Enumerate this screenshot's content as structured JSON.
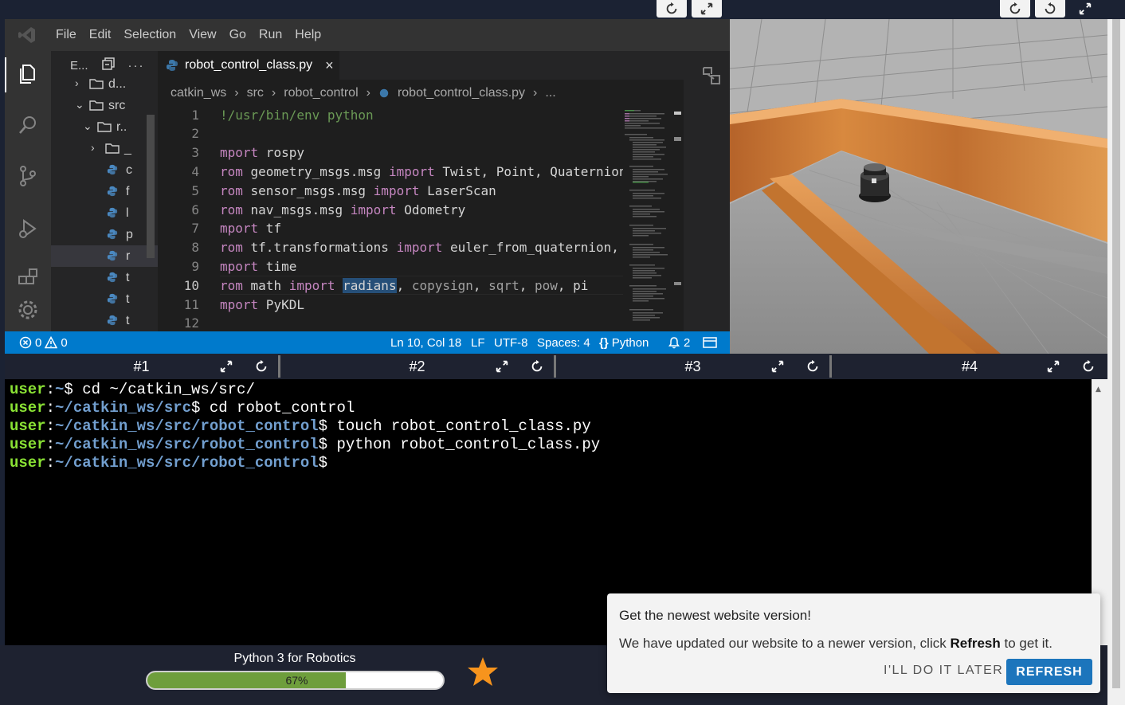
{
  "top_controls": {
    "left_group": [
      "reload",
      "fullscreen"
    ],
    "right_group": [
      "reload",
      "refresh",
      "fullscreen"
    ]
  },
  "vscode": {
    "menu": [
      "File",
      "Edit",
      "Selection",
      "View",
      "Go",
      "Run",
      "Help"
    ],
    "explorer_label": "E...",
    "explorer_tree": [
      {
        "label": "d...",
        "type": "folder",
        "partial": true
      },
      {
        "label": "src",
        "type": "folder-open"
      },
      {
        "label": "r..",
        "type": "folder-open"
      },
      {
        "label": "_",
        "type": "folder"
      },
      {
        "label": "c",
        "type": "python"
      },
      {
        "label": "f",
        "type": "python"
      },
      {
        "label": "l",
        "type": "python"
      },
      {
        "label": "p",
        "type": "python"
      },
      {
        "label": "r",
        "type": "python",
        "selected": true
      },
      {
        "label": "t",
        "type": "python"
      },
      {
        "label": "t",
        "type": "python"
      },
      {
        "label": "t",
        "type": "python"
      }
    ],
    "tab": {
      "name": "robot_control_class.py",
      "close": "×"
    },
    "breadcrumb": [
      "catkin_ws",
      "src",
      "robot_control",
      "robot_control_class.py",
      "..."
    ],
    "code_lines": [
      {
        "n": "1",
        "tokens": [
          {
            "t": "!/usr/bin/env python",
            "c": "cm"
          }
        ]
      },
      {
        "n": "2",
        "tokens": []
      },
      {
        "n": "3",
        "tokens": [
          {
            "t": "mport",
            "c": "kw"
          },
          {
            "t": " rospy",
            "c": ""
          }
        ]
      },
      {
        "n": "4",
        "tokens": [
          {
            "t": "rom",
            "c": "kw"
          },
          {
            "t": " geometry_msgs.msg ",
            "c": ""
          },
          {
            "t": "import",
            "c": "kw"
          },
          {
            "t": " Twist, Point, Quaternion",
            "c": ""
          }
        ]
      },
      {
        "n": "5",
        "tokens": [
          {
            "t": "rom",
            "c": "kw"
          },
          {
            "t": " sensor_msgs.msg ",
            "c": ""
          },
          {
            "t": "import",
            "c": "kw"
          },
          {
            "t": " LaserScan",
            "c": ""
          }
        ]
      },
      {
        "n": "6",
        "tokens": [
          {
            "t": "rom",
            "c": "kw"
          },
          {
            "t": " nav_msgs.msg ",
            "c": ""
          },
          {
            "t": "import",
            "c": "kw"
          },
          {
            "t": " Odometry",
            "c": ""
          }
        ]
      },
      {
        "n": "7",
        "tokens": [
          {
            "t": "mport",
            "c": "kw"
          },
          {
            "t": " tf",
            "c": ""
          }
        ]
      },
      {
        "n": "8",
        "tokens": [
          {
            "t": "rom",
            "c": "kw"
          },
          {
            "t": " tf.transformations ",
            "c": ""
          },
          {
            "t": "import",
            "c": "kw"
          },
          {
            "t": " euler_from_quaternion,",
            "c": ""
          }
        ]
      },
      {
        "n": "9",
        "tokens": [
          {
            "t": "mport",
            "c": "kw"
          },
          {
            "t": " time",
            "c": ""
          }
        ]
      },
      {
        "n": "10",
        "current": true,
        "tokens": [
          {
            "t": "rom",
            "c": "kw"
          },
          {
            "t": " math ",
            "c": ""
          },
          {
            "t": "import",
            "c": "kw"
          },
          {
            "t": " ",
            "c": ""
          },
          {
            "t": "radians",
            "c": "hl"
          },
          {
            "t": ", ",
            "c": ""
          },
          {
            "t": "copysign",
            "c": "dim"
          },
          {
            "t": ", ",
            "c": ""
          },
          {
            "t": "sqrt",
            "c": "dim"
          },
          {
            "t": ", ",
            "c": ""
          },
          {
            "t": "pow",
            "c": "dim"
          },
          {
            "t": ", pi",
            "c": ""
          }
        ]
      },
      {
        "n": "11",
        "tokens": [
          {
            "t": "mport",
            "c": "kw"
          },
          {
            "t": " PyKDL",
            "c": ""
          }
        ]
      },
      {
        "n": "12",
        "tokens": []
      }
    ],
    "status": {
      "errors": "0",
      "warnings": "0",
      "position": "Ln 10, Col 18",
      "eol": "LF",
      "encoding": "UTF-8",
      "spaces": "Spaces: 4",
      "language": "Python",
      "notifications": "2"
    }
  },
  "terminal_tabs": [
    {
      "label": "#1"
    },
    {
      "label": "#2"
    },
    {
      "label": "#3"
    },
    {
      "label": "#4"
    }
  ],
  "terminal_lines": [
    {
      "user": "user",
      "path": "~",
      "cmd": " cd ~/catkin_ws/src/"
    },
    {
      "user": "user",
      "path": "~/catkin_ws/src",
      "cmd": " cd robot_control"
    },
    {
      "user": "user",
      "path": "~/catkin_ws/src/robot_control",
      "cmd": " touch robot_control_class.py"
    },
    {
      "user": "user",
      "path": "~/catkin_ws/src/robot_control",
      "cmd": " python robot_control_class.py"
    },
    {
      "user": "user",
      "path": "~/catkin_ws/src/robot_control",
      "cmd": ""
    }
  ],
  "course": {
    "title": "Python 3 for Robotics",
    "progress_label": "67%",
    "progress": 0.67
  },
  "toast": {
    "title": "Get the newest website version!",
    "body_pre": "We have updated our website to a newer version, click ",
    "body_bold": "Refresh",
    "body_post": " to get it.",
    "later": "I'LL DO IT LATER",
    "refresh": "REFRESH"
  },
  "colors": {
    "vscode_status": "#007acc",
    "progress_fill": "#6e9e3c",
    "refresh_button": "#1c75bc",
    "star": "#f7941d"
  }
}
